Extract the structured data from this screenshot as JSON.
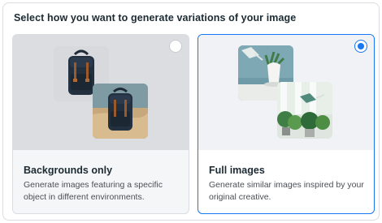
{
  "heading": "Select how you want to generate variations of your image",
  "options": [
    {
      "id": "backgrounds-only",
      "title": "Backgrounds only",
      "description": "Generate images featuring a specific object in different environments.",
      "selected": false
    },
    {
      "id": "full-images",
      "title": "Full images",
      "description": "Generate similar images inspired by your original creative.",
      "selected": true
    }
  ],
  "colors": {
    "accent": "#1877f2",
    "border": "#dadde1",
    "text_primary": "#1c2b33",
    "text_secondary": "#4b4f56"
  }
}
